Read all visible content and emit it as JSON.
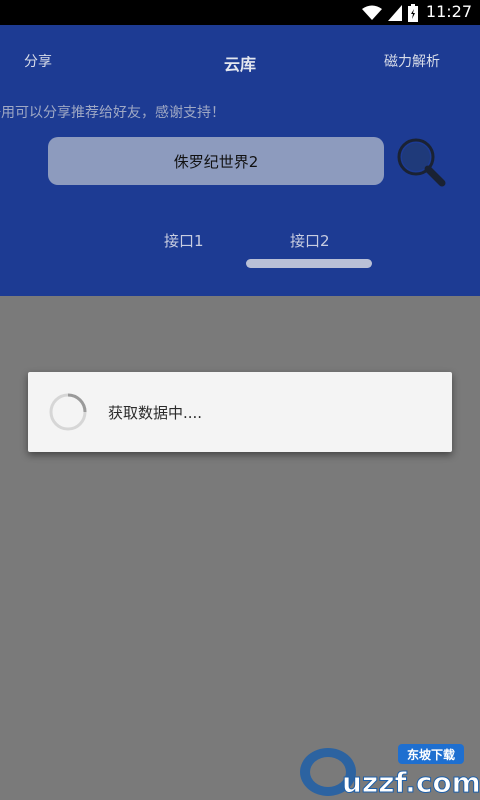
{
  "status_bar": {
    "time": "11:27",
    "icons": [
      "wifi-icon",
      "signal-icon",
      "battery-icon"
    ]
  },
  "header": {
    "tabs": [
      {
        "label": "分享"
      },
      {
        "label": "云库"
      },
      {
        "label": "磁力解析"
      }
    ],
    "marquee": "好用可以分享推荐给好友，感谢支持！"
  },
  "search": {
    "value": "侏罗纪世界2",
    "button_icon": "search-icon"
  },
  "api_tabs": [
    {
      "label": "接口1"
    },
    {
      "label": "接口2"
    }
  ],
  "selected_api_tab": 1,
  "dialog": {
    "message": "获取数据中...."
  },
  "watermark": {
    "text": "uzzf.com",
    "badge": "东坡下载"
  },
  "colors": {
    "header_bg": "#1d3b93",
    "overlay": "#7a7a7a",
    "dialog_bg": "#f4f4f4"
  }
}
